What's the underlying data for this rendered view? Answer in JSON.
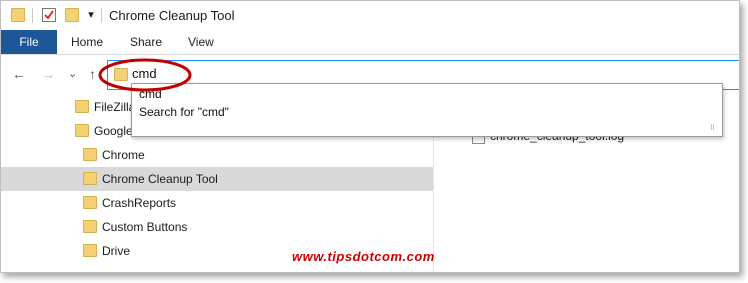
{
  "window": {
    "title": "Chrome Cleanup Tool",
    "quick_access_dropdown": "▾"
  },
  "ribbon": {
    "file_label": "File",
    "tabs": [
      {
        "label": "Home"
      },
      {
        "label": "Share"
      },
      {
        "label": "View"
      }
    ]
  },
  "nav": {
    "back": "←",
    "forward": "→",
    "recent": "⌄",
    "up": "↑"
  },
  "address": {
    "value": "cmd"
  },
  "suggestions": [
    {
      "label": "cmd"
    },
    {
      "label": "Search for \"cmd\""
    }
  ],
  "tree": {
    "items": [
      {
        "label": "FileZilla",
        "selected": false
      },
      {
        "label": "Google",
        "selected": false
      },
      {
        "label": "Chrome",
        "selected": false
      },
      {
        "label": "Chrome Cleanup Tool",
        "selected": true
      },
      {
        "label": "CrashReports",
        "selected": false
      },
      {
        "label": "Custom Buttons",
        "selected": false
      },
      {
        "label": "Drive",
        "selected": false
      }
    ]
  },
  "files": [
    {
      "name": "chrome_cleanup_tool.log"
    }
  ],
  "watermark": "www.tipsdotcom.com",
  "colors": {
    "file_tab": "#1e5799",
    "address_focus": "#1e90ff",
    "highlight_ellipse": "#c00000",
    "folder": "#f3d175",
    "selected_row": "#d9d9d9",
    "watermark": "#cc0000"
  }
}
